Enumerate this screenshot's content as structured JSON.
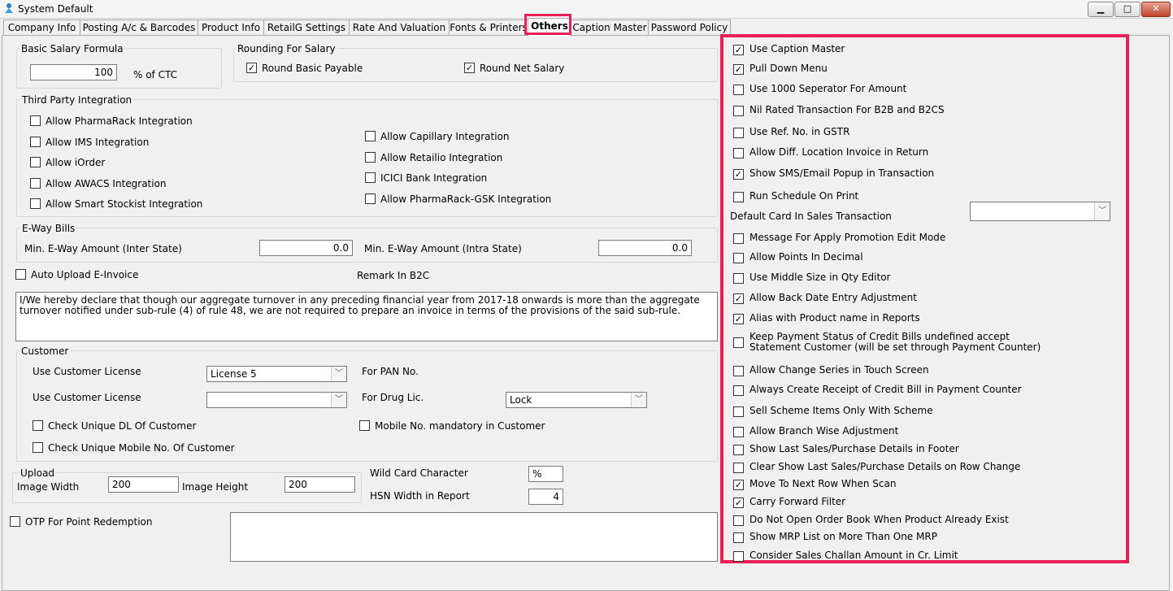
{
  "window": {
    "title": "System Default",
    "minimize": "▁",
    "maximize": "□",
    "close": "✕",
    "app_icon": "app-icon"
  },
  "tabs": [
    "Company Info",
    "Posting A/c & Barcodes",
    "Product Info",
    "RetailG Settings",
    "Rate And Valuation",
    "Fonts & Printers",
    "Others",
    "Caption Master",
    "Password Policy"
  ],
  "basic_salary": {
    "label": "Basic Salary Formula",
    "value": "100",
    "unit": "% of CTC"
  },
  "rounding": {
    "label": "Rounding For Salary",
    "round_basic": "Round Basic Payable",
    "round_net": "Round Net Salary",
    "round_basic_checked": true,
    "round_net_checked": true
  },
  "third_party": {
    "label": "Third Party Integration",
    "left": [
      "Allow PharmaRack Integration",
      "Allow IMS Integration",
      "Allow iOrder",
      "Allow AWACS Integration",
      "Allow Smart Stockist Integration"
    ],
    "right": [
      "Allow Capillary Integration",
      "Allow Retailio Integration",
      "ICICI Bank Integration",
      "Allow PharmaRack-GSK Integration"
    ]
  },
  "eway": {
    "label": "E-Way Bills",
    "inter_label": "Min. E-Way Amount (Inter State)",
    "inter_value": "0.0",
    "intra_label": "Min. E-Way Amount (Intra State)",
    "intra_value": "0.0"
  },
  "auto_upload": "Auto Upload E-Invoice",
  "remark_b2c": "Remark In B2C",
  "declaration": "I/We hereby declare that though our aggregate turnover in any preceding financial year from 2017-18 onwards is more than the aggregate turnover notified under sub-rule (4) of rule 48, we are not required to prepare an invoice in terms of the provisions of the said sub-rule.",
  "customer": {
    "label": "Customer",
    "license1_label": "Use Customer License",
    "license1_value": "License 5",
    "license2_label": "Use Customer License",
    "license2_value": "",
    "pan_label": "For PAN No.",
    "drug_label": "For Drug Lic.",
    "drug_value": "Lock",
    "unique_dl": "Check Unique DL Of Customer",
    "unique_mobile": "Check Unique Mobile No. Of Customer",
    "mobile_mandatory": "Mobile No. mandatory in Customer"
  },
  "upload": {
    "label": "Upload",
    "width_label": "Image Width",
    "width_value": "200",
    "height_label": "Image Height",
    "height_value": "200"
  },
  "wildcard": {
    "label": "Wild Card Character",
    "value": "%"
  },
  "hsn": {
    "label": "HSN Width in Report",
    "value": "4"
  },
  "otp": "OTP For Point Redemption",
  "others_options": [
    {
      "label": "Use Caption Master",
      "checked": true
    },
    {
      "label": "Pull Down Menu",
      "checked": true
    },
    {
      "label": "Use 1000 Seperator For Amount",
      "checked": false
    },
    {
      "label": "Nil Rated Transaction For B2B and B2CS",
      "checked": false
    },
    {
      "label": "Use Ref. No. in GSTR",
      "checked": false
    },
    {
      "label": "Allow Diff. Location Invoice in Return",
      "checked": false
    },
    {
      "label": "Show SMS/Email Popup in Transaction",
      "checked": true
    },
    {
      "label": "Run Schedule On Print",
      "checked": false
    },
    {
      "label": "Message For Apply Promotion Edit Mode",
      "checked": false
    },
    {
      "label": "Allow Points In Decimal",
      "checked": false
    },
    {
      "label": "Use Middle Size in Qty Editor",
      "checked": false
    },
    {
      "label": "Allow Back Date Entry Adjustment",
      "checked": true
    },
    {
      "label": "Alias with Product name in Reports",
      "checked": true
    },
    {
      "label": "Keep Payment Status of Credit Bills undefined accept",
      "label2": " Statement Customer (will be set through Payment Counter)",
      "checked": false
    },
    {
      "label": "Allow Change Series in Touch Screen",
      "checked": false
    },
    {
      "label": "Always Create Receipt of Credit Bill in Payment Counter",
      "checked": false
    },
    {
      "label": "Sell Scheme Items Only With Scheme",
      "checked": false
    },
    {
      "label": "Allow Branch Wise Adjustment",
      "checked": false
    },
    {
      "label": "Show Last Sales/Purchase Details in Footer",
      "checked": false
    },
    {
      "label": "Clear Show Last Sales/Purchase Details on Row Change",
      "checked": false
    },
    {
      "label": "Move To Next Row When Scan",
      "checked": true
    },
    {
      "label": "Carry Forward Filter",
      "checked": true
    },
    {
      "label": "Do Not Open Order Book When Product Already Exist",
      "checked": false
    },
    {
      "label": "Show MRP List on More Than One MRP",
      "checked": false
    },
    {
      "label": "Consider Sales Challan Amount in Cr. Limit",
      "checked": false
    }
  ],
  "default_card": {
    "label": "Default Card In Sales Transaction",
    "value": ""
  }
}
